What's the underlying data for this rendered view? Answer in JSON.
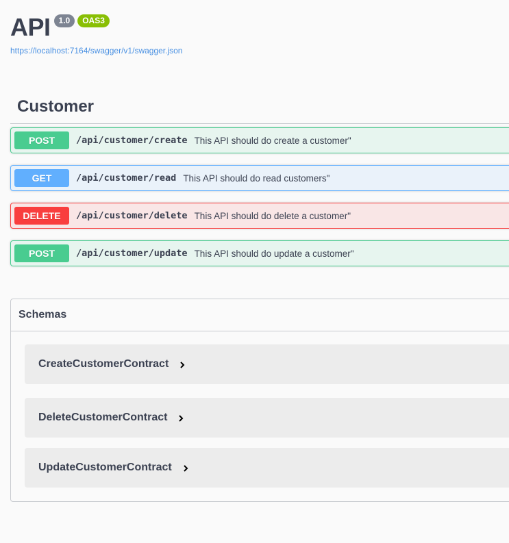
{
  "info": {
    "title": "API",
    "version": "1.0",
    "oas": "OAS3",
    "spec_url": "https://localhost:7164/swagger/v1/swagger.json"
  },
  "tag": {
    "name": "Customer"
  },
  "operations": [
    {
      "method": "POST",
      "path": "/api/customer/create",
      "summary": "This API should do create a customer\""
    },
    {
      "method": "GET",
      "path": "/api/customer/read",
      "summary": "This API should do read customers\""
    },
    {
      "method": "DELETE",
      "path": "/api/customer/delete",
      "summary": "This API should do delete a customer\""
    },
    {
      "method": "POST",
      "path": "/api/customer/update",
      "summary": "This API should do update a customer\""
    }
  ],
  "schemas": {
    "title": "Schemas",
    "models": [
      {
        "name": "CreateCustomerContract",
        "icon": "chevron-right-icon"
      },
      {
        "name": "DeleteCustomerContract",
        "icon": "chevron-right-icon"
      },
      {
        "name": "UpdateCustomerContract",
        "icon": "chevron-right-icon"
      }
    ]
  },
  "colors": {
    "post": "#49cc90",
    "get": "#61affe",
    "delete": "#f93e3e",
    "link": "#4990e2",
    "text": "#3b4151"
  }
}
